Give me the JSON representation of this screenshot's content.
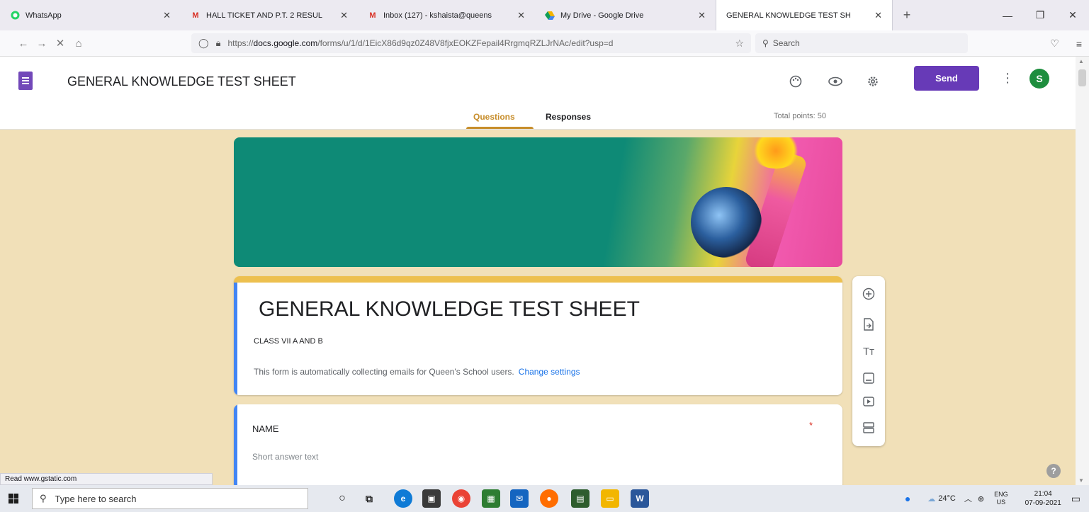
{
  "browser": {
    "tabs": [
      {
        "title": "WhatsApp",
        "icon": "whatsapp-icon",
        "color": "#25d366"
      },
      {
        "title": "HALL TICKET AND P.T. 2 RESUL",
        "icon": "gmail-icon",
        "color": "#d93025"
      },
      {
        "title": "Inbox (127) - kshaista@queens",
        "icon": "gmail-icon",
        "color": "#d93025"
      },
      {
        "title": "My Drive - Google Drive",
        "icon": "drive-icon",
        "color": "#f4b400"
      },
      {
        "title": "GENERAL KNOWLEDGE TEST SH",
        "icon": "none",
        "color": "#ffffff"
      }
    ],
    "new_tab": "+",
    "url_host": "docs.google.com",
    "url_prefix": "https://",
    "url_path": "/forms/u/1/d/1EicX86d9qz0Z48V8fjxEOKZFepail4RrgmqRZLJrNAc/edit?usp=d",
    "search_placeholder": "Search"
  },
  "form": {
    "app_title": "GENERAL KNOWLEDGE TEST SHEET",
    "send_label": "Send",
    "avatar_letter": "S",
    "tabs": {
      "questions": "Questions",
      "responses": "Responses"
    },
    "total_points": "Total points: 50",
    "title": "GENERAL KNOWLEDGE TEST SHEET",
    "description": "CLASS VII A AND B",
    "email_note": "This form is automatically collecting emails for Queen's School users.",
    "change_settings": "Change settings",
    "question": {
      "title": "NAME",
      "required_marker": "*",
      "hint": "Short answer text"
    },
    "theme_color": "#673ab7",
    "accent_color": "#edc04f",
    "background_color": "#f1e0b8"
  },
  "status_tip": "Read www.gstatic.com",
  "taskbar": {
    "search_placeholder": "Type here to search",
    "weather": "24°C",
    "lang_top": "ENG",
    "lang_bottom": "US",
    "time": "21:04",
    "date": "07-09-2021"
  }
}
